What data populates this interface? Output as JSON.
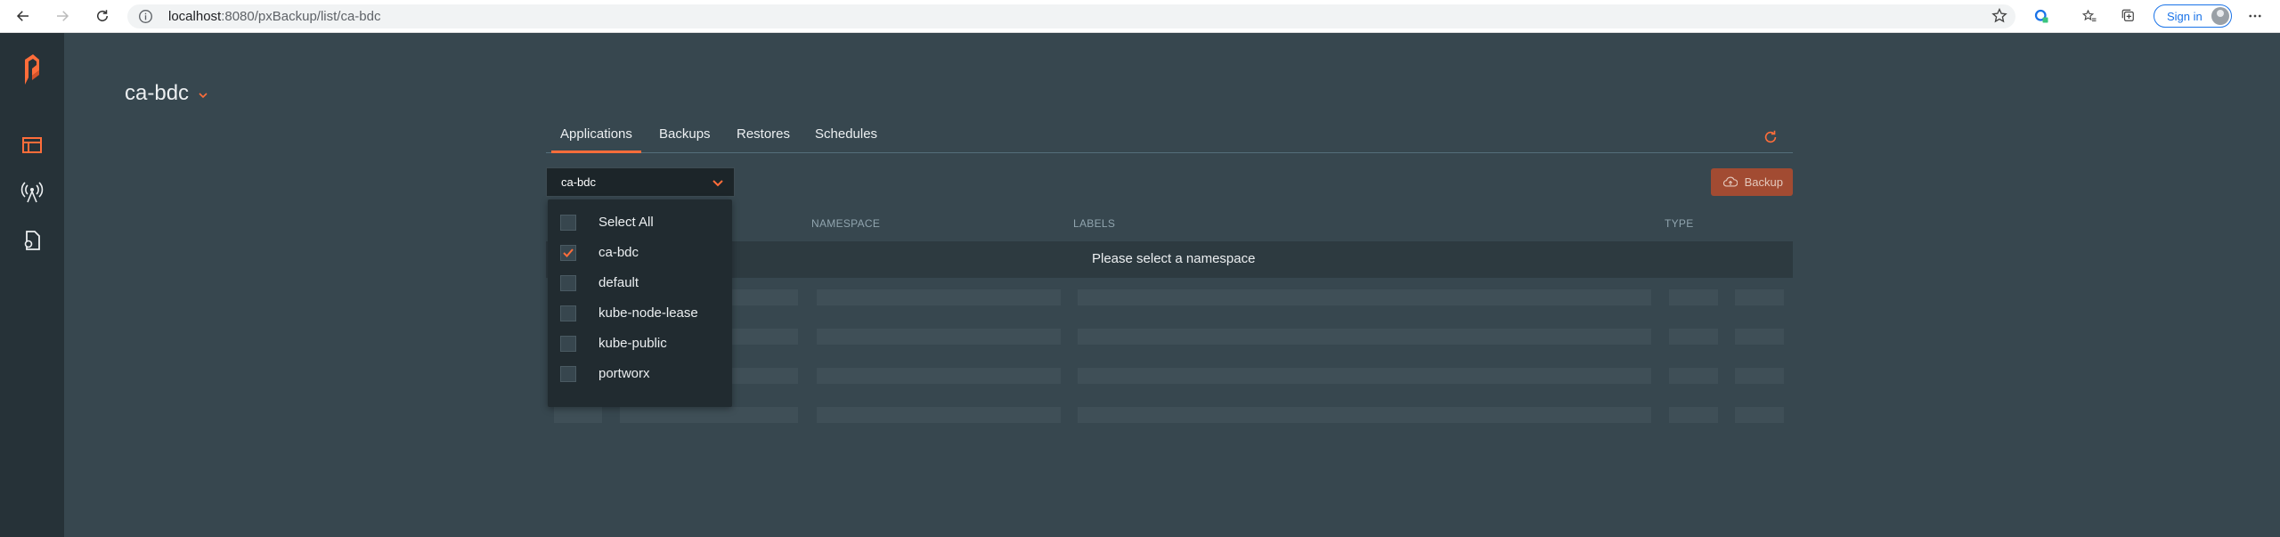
{
  "browser": {
    "url_host": "localhost",
    "url_rest": ":8080/pxBackup/list/ca-bdc",
    "signin_label": "Sign in"
  },
  "sidebar": {
    "items": [
      {
        "icon": "portworx-logo"
      },
      {
        "icon": "applications-icon"
      },
      {
        "icon": "antenna-icon"
      },
      {
        "icon": "settings-document-icon"
      }
    ]
  },
  "header": {
    "namespace_title": "ca-bdc"
  },
  "tabs": [
    "Applications",
    "Backups",
    "Restores",
    "Schedules"
  ],
  "active_tab": "Applications",
  "namespace_select": {
    "value": "ca-bdc",
    "options": [
      {
        "label": "Select All",
        "checked": false
      },
      {
        "label": "ca-bdc",
        "checked": true
      },
      {
        "label": "default",
        "checked": false
      },
      {
        "label": "kube-node-lease",
        "checked": false
      },
      {
        "label": "kube-public",
        "checked": false
      },
      {
        "label": "portworx",
        "checked": false
      }
    ]
  },
  "backup_button": "Backup",
  "table": {
    "columns": [
      "NAMESPACE",
      "LABELS",
      "TYPE"
    ],
    "empty_message": "Please select a namespace"
  },
  "colors": {
    "accent": "#ff6d3a",
    "background": "#37474f",
    "sidebar": "#263238",
    "backup_button": "#a24b32"
  }
}
